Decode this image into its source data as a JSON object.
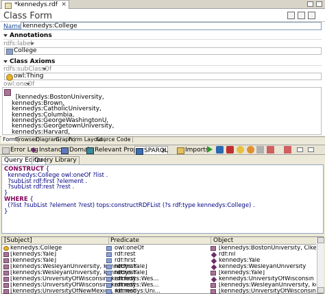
{
  "editor_tab": {
    "title": "*kennedys.rdf"
  },
  "form": {
    "title": "Class Form",
    "name_label": "Name:",
    "name_value": "kennedys:College",
    "annotations_label": "Annotations",
    "rdfs_label_prop": "rdfs:label",
    "label_value": "College",
    "class_axioms_label": "Class Axioms",
    "subclassof_prop": "rdfs:subClassOf",
    "subclassof_value": "owl:Thing",
    "oneof_prop": "owl:oneOf",
    "oneof_values": "[kennedys:BostonUniversity,\nkennedys:Brown,\nkennedys:CatholicUniversity,\nkennedys:Columbia,\nkennedys:GeorgeWashingtonU,\nkennedys:GeorgetownUniversity,\nkennedys:Harvard,\nkennedys:ManhattanvilleCollege,\nkennedys:NYU,"
  },
  "bottom_tabs": [
    "Form",
    "Browser",
    "Diagram",
    "Graph",
    "Form Layout",
    "Source Code"
  ],
  "view_tabs": {
    "error_log": "Error Log",
    "instances": "Instances",
    "domain": "Domain",
    "relevant_properties": "Relevant Properties",
    "sparql": "SPARQL",
    "imports": "Imports"
  },
  "query_tabs": {
    "editor": "Query Editor",
    "library": "Query Library"
  },
  "query": {
    "construct_kw": "CONSTRUCT",
    "construct_rest": " {\n  kennedys:College owl:oneOf ?list .\n  ?subList rdf:first ?element .\n  ?subList rdf:rest ?rest .\n}\n",
    "where_kw": "WHERE",
    "where_rest": " {\n  (?list ?subList ?element ?rest) tops:constructRDFList (?s rdf:type kennedys:College) .\n}"
  },
  "results": {
    "columns": [
      "[Subject]",
      "Predicate",
      "Object"
    ],
    "rows": [
      {
        "subject": "kennedys:College",
        "predicate": "owl:oneOf",
        "object": "[kennedys:BostonUniversity, Clkennedys:Br..."
      },
      {
        "subject": "[kennedys:Yale]",
        "predicate": "rdf:rest",
        "object": "rdf:nil"
      },
      {
        "subject": "[kennedys:Yale]",
        "predicate": "rdf:first",
        "object": "kennedys:Yale"
      },
      {
        "subject": "[kennedys:WesleyanUniversity, kennedys:Yale]",
        "predicate": "rdf:first",
        "object": "kennedys:WesleyanUniversity"
      },
      {
        "subject": "[kennedys:WesleyanUniversity, kennedys:Yale]",
        "predicate": "rdf:rest",
        "object": "[kennedys:Yale]"
      },
      {
        "subject": "[kennedys:UniversityOfWisconsin, kennedys:Wes...",
        "predicate": "rdf:first",
        "object": "kennedys:UniversityOfWisconsin"
      },
      {
        "subject": "[kennedys:UniversityOfWisconsin, kennedys:Wes...",
        "predicate": "rdf:rest",
        "object": "[kennedys:WesleyanUniversity, kennedys:Yale]"
      },
      {
        "subject": "[kennedys:UniversityOfNewMexico, kennedys:Uni...",
        "predicate": "rdf:rest",
        "object": "[kennedys:UniversityOfWisconsin, kennedys:W..."
      },
      {
        "subject": "[kennedys:UniversityOfNewMexico, kennedys:...",
        "predicate": "rdf:first",
        "object": "kennedys:UniversityOfNewMexico"
      }
    ]
  }
}
